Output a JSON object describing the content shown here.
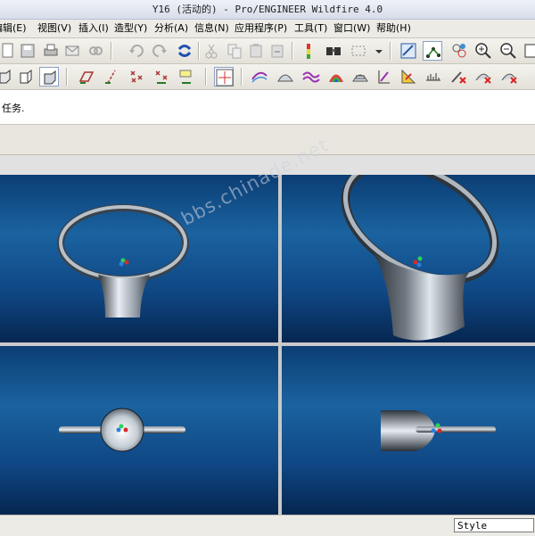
{
  "window": {
    "title": "Y16 (活动的) - Pro/ENGINEER Wildfire 4.0"
  },
  "menu": {
    "items": [
      {
        "id": "edit",
        "label": "编辑(E)"
      },
      {
        "id": "view",
        "label": "视图(V)"
      },
      {
        "id": "insert",
        "label": "插入(I)"
      },
      {
        "id": "shape",
        "label": "造型(Y)"
      },
      {
        "id": "analysis",
        "label": "分析(A)"
      },
      {
        "id": "info",
        "label": "信息(N)"
      },
      {
        "id": "apps",
        "label": "应用程序(P)"
      },
      {
        "id": "tools",
        "label": "工具(T)"
      },
      {
        "id": "window",
        "label": "窗口(W)"
      },
      {
        "id": "help",
        "label": "帮助(H)"
      }
    ]
  },
  "toolbar": {
    "row1": [
      "new-icon",
      "save-icon",
      "print-icon",
      "email-icon",
      "link-icon",
      "undo-icon",
      "redo-icon",
      "regenerate-icon",
      "cut-icon",
      "copy-icon",
      "paste-icon",
      "paste-special-icon",
      "model-tree-icon",
      "search-icon",
      "select-box-icon",
      "filter-dropdown-icon",
      "sketch-view-icon",
      "spline-icon",
      "network-icon",
      "zoom-in-icon",
      "zoom-out-icon",
      "refit-icon"
    ],
    "row2": [
      "shaded-icon",
      "hidden-line-icon",
      "no-hidden-icon",
      "shading-active-icon",
      "datum-plane-icon",
      "datum-axis-icon",
      "datum-point-icon",
      "coordinate-system-icon",
      "annotation-icon",
      "single-view-icon",
      "curve-analysis-icon",
      "surface-analysis-icon",
      "curvature-icon",
      "reflection-icon",
      "slope-icon",
      "draft-icon",
      "section-icon",
      "offset-icon",
      "delete-analysis-icon",
      "hide-analysis-icon"
    ]
  },
  "message": {
    "text": "任务."
  },
  "status": {
    "style_label": "Style"
  },
  "watermark": {
    "text": "bbs.chinade.net"
  },
  "viewport": {
    "background_top": "#0b3e74",
    "background_bottom": "#062650"
  }
}
